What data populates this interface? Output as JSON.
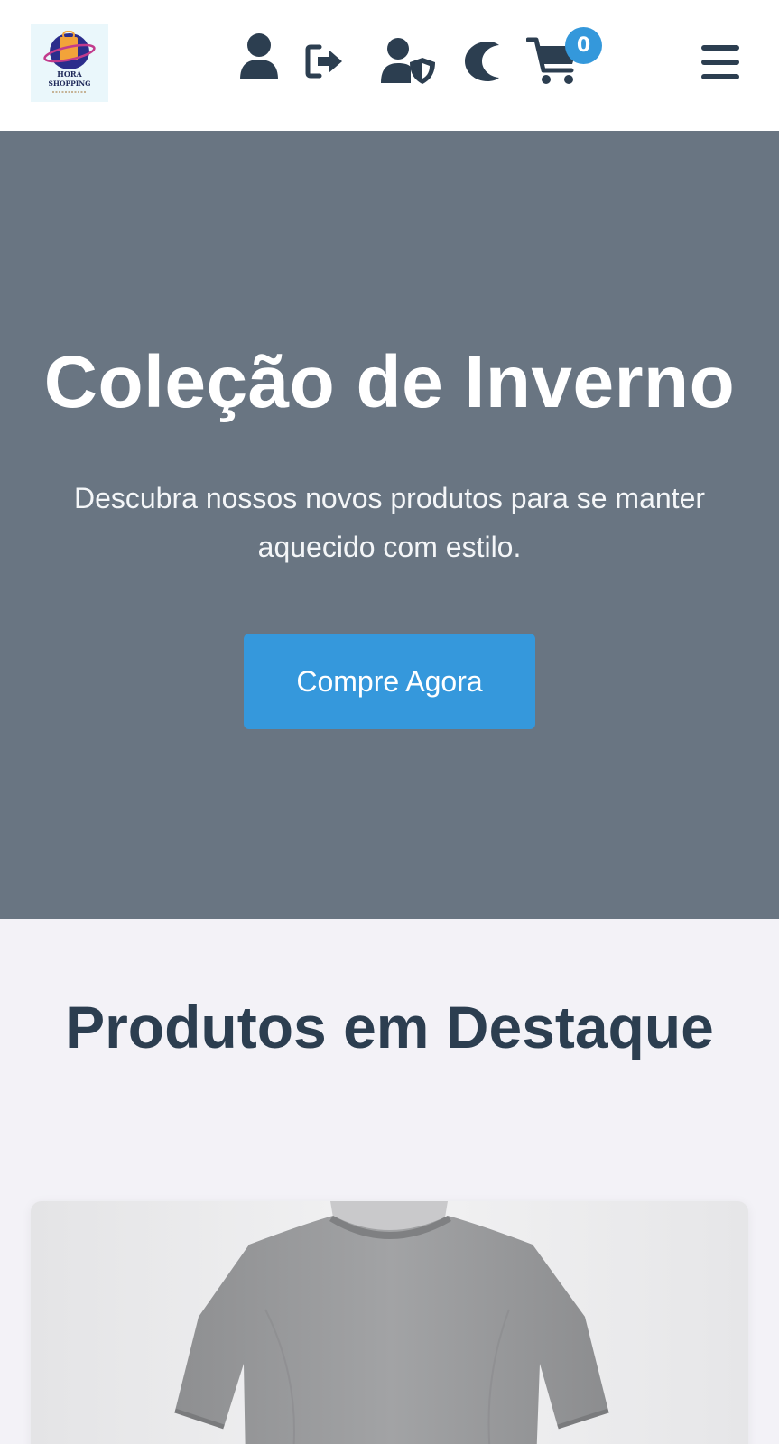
{
  "header": {
    "logo": {
      "line1": "HORA",
      "line2": "SHOPPING",
      "icon": "shopping-globe-logo"
    },
    "icons": [
      "user-icon",
      "logout-icon",
      "admin-shield-user-icon",
      "moon-icon",
      "cart-icon",
      "menu-icon"
    ],
    "cart_count": "0"
  },
  "hero": {
    "title": "Coleção de Inverno",
    "subtitle": "Descubra nossos novos produtos para se manter aquecido com estilo.",
    "button_label": "Compre Agora"
  },
  "featured": {
    "title": "Produtos em Destaque",
    "products": [
      {
        "image": "gray-tshirt-image"
      }
    ]
  },
  "colors": {
    "header_bg": "#ffffff",
    "icon": "#2c3e50",
    "hero_bg": "#697582",
    "accent": "#3498db",
    "page_bg": "#f3f2f7"
  }
}
